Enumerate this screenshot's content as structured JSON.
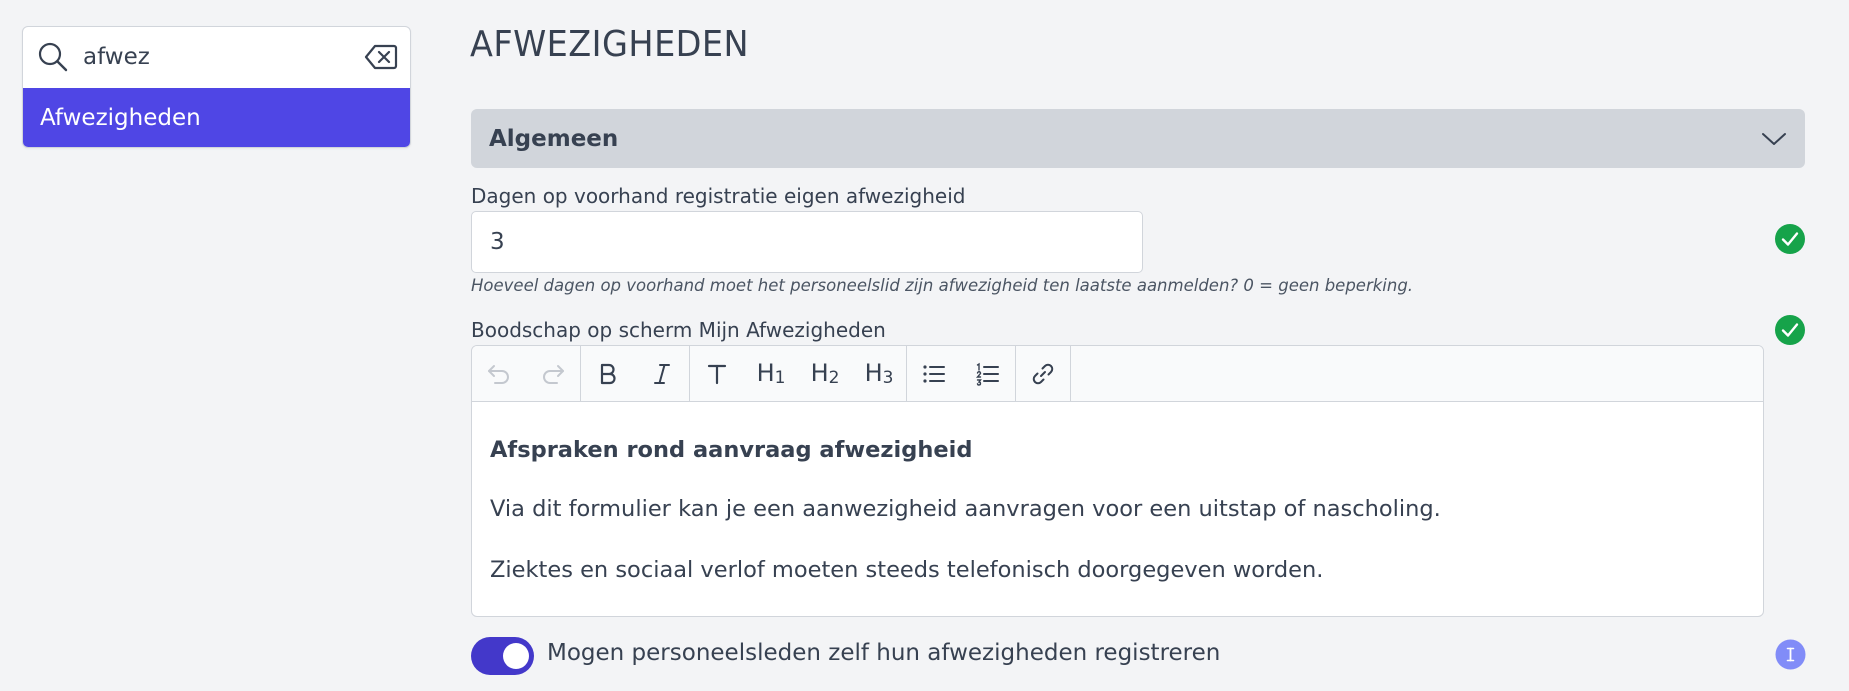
{
  "search": {
    "value": "afwez",
    "result": "Afwezigheden"
  },
  "page": {
    "title": "AFWEZIGHEDEN"
  },
  "section": {
    "title": "Algemeen"
  },
  "fields": {
    "days_label": "Dagen op voorhand registratie eigen afwezigheid",
    "days_value": "3",
    "days_help": "Hoeveel dagen op voorhand moet het personeelslid zijn afwezigheid ten laatste aanmelden? 0 = geen beperking.",
    "message_label": "Boodschap op scherm Mijn Afwezigheden"
  },
  "editor": {
    "toolbar": {
      "h1": "H",
      "h1_sub": "1",
      "h2": "H",
      "h2_sub": "2",
      "h3": "H",
      "h3_sub": "3"
    },
    "heading": "Afspraken rond aanvraag afwezigheid",
    "paragraph1": "Via dit formulier kan je een aanwezigheid aanvragen voor een uitstap of nascholing.",
    "paragraph2": "Ziektes en sociaal verlof moeten steeds telefonisch doorgegeven worden."
  },
  "toggle": {
    "label": "Mogen personeelsleden zelf hun afwezigheden registreren",
    "state": "on"
  },
  "colors": {
    "accent": "#4f46e5",
    "toggle": "#4338ca",
    "success": "#16a34a",
    "info": "#818cf8",
    "section_bg": "#d1d5db"
  },
  "icons": [
    "search-icon",
    "clear-icon",
    "chevron-down-icon",
    "check-circle-icon",
    "undo-icon",
    "redo-icon",
    "bold-icon",
    "italic-icon",
    "text-icon",
    "bullet-list-icon",
    "ordered-list-icon",
    "link-icon",
    "info-icon"
  ]
}
